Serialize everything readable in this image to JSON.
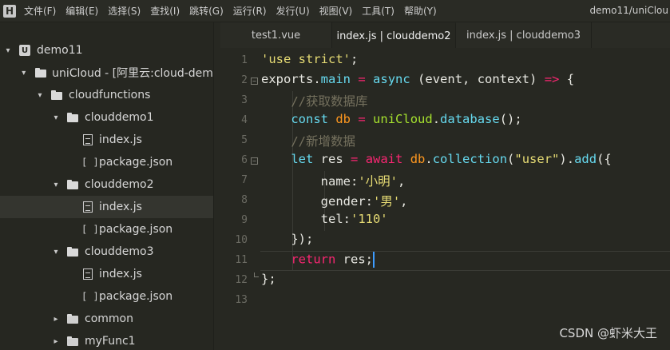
{
  "menubar": {
    "logo": "H",
    "items": [
      "文件(F)",
      "编辑(E)",
      "选择(S)",
      "查找(I)",
      "跳转(G)",
      "运行(R)",
      "发行(U)",
      "视图(V)",
      "工具(T)",
      "帮助(Y)"
    ],
    "window_title": "demo11/uniClou"
  },
  "sidebar": {
    "project": "demo11",
    "unicloud": "uniCloud - [阿里云:cloud-demo",
    "cloudfunctions": "cloudfunctions",
    "clouddemo1": "clouddemo1",
    "clouddemo1_index": "index.js",
    "clouddemo1_pkg": "package.json",
    "clouddemo2": "clouddemo2",
    "clouddemo2_index": "index.js",
    "clouddemo2_pkg": "package.json",
    "clouddemo3": "clouddemo3",
    "clouddemo3_index": "index.js",
    "clouddemo3_pkg": "package.json",
    "common": "common",
    "myFunc1": "myFunc1"
  },
  "tabs": [
    "test1.vue",
    "index.js | clouddemo2",
    "index.js | clouddemo3"
  ],
  "active_tab": 1,
  "editor": {
    "line_numbers": [
      "1",
      "2",
      "3",
      "4",
      "5",
      "6",
      "7",
      "8",
      "9",
      "10",
      "11",
      "12",
      "13"
    ],
    "current_line": 11,
    "lines": [
      [
        [
          "str",
          "'use strict'"
        ],
        [
          "plain",
          ";"
        ]
      ],
      [
        [
          "plain",
          "exports"
        ],
        [
          "plain",
          "."
        ],
        [
          "prop",
          "main"
        ],
        [
          "plain",
          " "
        ],
        [
          "kw",
          "="
        ],
        [
          "plain",
          " "
        ],
        [
          "prop",
          "async"
        ],
        [
          "plain",
          " (event, context) "
        ],
        [
          "kw",
          "=>"
        ],
        [
          "plain",
          " {"
        ]
      ],
      [
        [
          "plain",
          "    "
        ],
        [
          "com",
          "//获取数据库"
        ]
      ],
      [
        [
          "plain",
          "    "
        ],
        [
          "prop",
          "const"
        ],
        [
          "plain",
          " "
        ],
        [
          "var",
          "db"
        ],
        [
          "plain",
          " "
        ],
        [
          "kw",
          "="
        ],
        [
          "plain",
          " "
        ],
        [
          "fn",
          "uniCloud"
        ],
        [
          "plain",
          "."
        ],
        [
          "prop",
          "database"
        ],
        [
          "plain",
          "();"
        ]
      ],
      [
        [
          "plain",
          "    "
        ],
        [
          "com",
          "//新增数据"
        ]
      ],
      [
        [
          "plain",
          "    "
        ],
        [
          "prop",
          "let"
        ],
        [
          "plain",
          " res "
        ],
        [
          "kw",
          "="
        ],
        [
          "plain",
          " "
        ],
        [
          "kw",
          "await"
        ],
        [
          "plain",
          " "
        ],
        [
          "var",
          "db"
        ],
        [
          "plain",
          "."
        ],
        [
          "prop",
          "collection"
        ],
        [
          "plain",
          "("
        ],
        [
          "str",
          "\"user\""
        ],
        [
          "plain",
          ")."
        ],
        [
          "prop",
          "add"
        ],
        [
          "plain",
          "({"
        ]
      ],
      [
        [
          "plain",
          "        name:"
        ],
        [
          "str",
          "'小明'"
        ],
        [
          "plain",
          ","
        ]
      ],
      [
        [
          "plain",
          "        gender:"
        ],
        [
          "str",
          "'男'"
        ],
        [
          "plain",
          ","
        ]
      ],
      [
        [
          "plain",
          "        tel:"
        ],
        [
          "str",
          "'110'"
        ]
      ],
      [
        [
          "plain",
          "    });"
        ]
      ],
      [
        [
          "plain",
          "    "
        ],
        [
          "kw",
          "return"
        ],
        [
          "plain",
          " res;"
        ]
      ],
      [
        [
          "plain",
          "};"
        ]
      ],
      []
    ]
  },
  "watermark": "CSDN @虾米大王",
  "colors": {
    "background": "#272822",
    "string": "#e6db74",
    "keyword": "#f92672",
    "property": "#66d9ef",
    "function": "#a6e22e",
    "comment": "#75715e",
    "variable": "#fd971f",
    "caret": "#3d9cff"
  }
}
